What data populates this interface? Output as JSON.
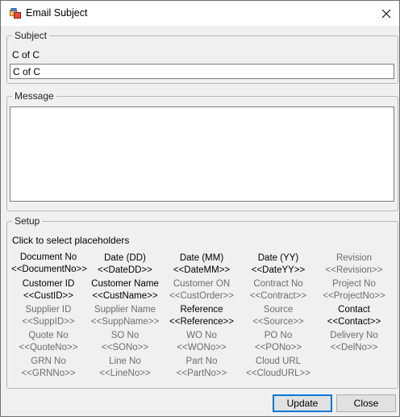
{
  "window": {
    "title": "Email Subject"
  },
  "subject": {
    "legend": "Subject",
    "label": "C of C",
    "value": "C of C"
  },
  "message": {
    "legend": "Message",
    "value": ""
  },
  "setup": {
    "legend": "Setup",
    "hint": "Click to select placeholders",
    "placeholders": [
      {
        "name": "Document No",
        "token": "<<DocumentNo>>"
      },
      {
        "name": "Date (DD)",
        "token": "<<DateDD>>"
      },
      {
        "name": "Date (MM)",
        "token": "<<DateMM>>"
      },
      {
        "name": "Date (YY)",
        "token": "<<DateYY>>"
      },
      {
        "name": "Revision",
        "token": "<<Revision>>"
      },
      {
        "name": "Customer ID",
        "token": "<<CustID>>"
      },
      {
        "name": "Customer Name",
        "token": "<<CustName>>"
      },
      {
        "name": "Customer ON",
        "token": "<<CustOrder>>"
      },
      {
        "name": "Contract No",
        "token": "<<Contract>>"
      },
      {
        "name": "Project No",
        "token": "<<ProjectNo>>"
      },
      {
        "name": "Supplier ID",
        "token": "<<SuppID>>"
      },
      {
        "name": "Supplier Name",
        "token": "<<SuppName>>"
      },
      {
        "name": "Reference",
        "token": "<<Reference>>"
      },
      {
        "name": "Source",
        "token": "<<Source>>"
      },
      {
        "name": "Contact",
        "token": "<<Contact>>"
      },
      {
        "name": "Quote No",
        "token": "<<QuoteNo>>"
      },
      {
        "name": "SO No",
        "token": "<<SONo>>"
      },
      {
        "name": "WO No",
        "token": "<<WONo>>"
      },
      {
        "name": "PO No",
        "token": "<<PONo>>"
      },
      {
        "name": "Delivery No",
        "token": "<<DelNo>>"
      },
      {
        "name": "GRN No",
        "token": "<<GRNNo>>"
      },
      {
        "name": "Line No",
        "token": "<<LineNo>>"
      },
      {
        "name": "Part No",
        "token": "<<PartNo>>"
      },
      {
        "name": "Cloud URL",
        "token": "<<CloudURL>>"
      }
    ]
  },
  "buttons": {
    "update": "Update",
    "close": "Close"
  },
  "colors": {
    "placeholder_dark": "#000000",
    "placeholder_dim": "#6d6d6d",
    "default_button_border": "#0078d7"
  }
}
